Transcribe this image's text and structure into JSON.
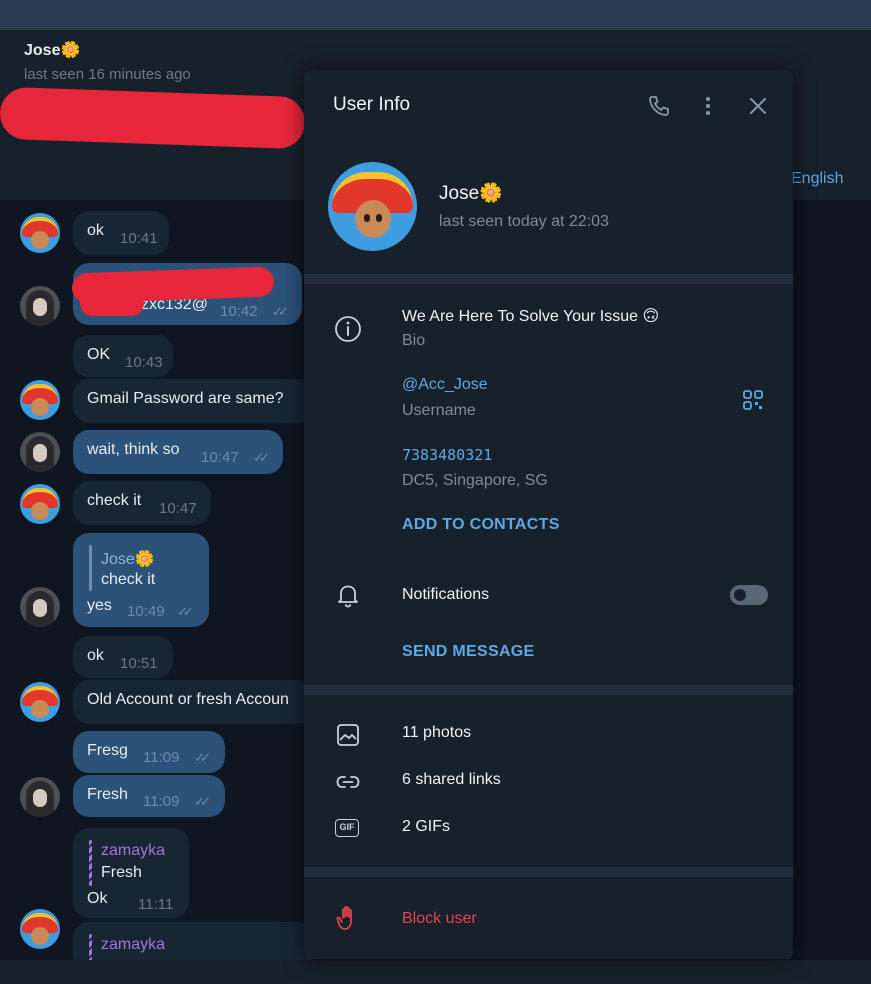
{
  "chat": {
    "name": "Jose🌼",
    "status": "last seen 16 minutes ago",
    "translate_label": "English"
  },
  "messages": [
    {
      "text": "ok",
      "time": "10:41"
    },
    {
      "text": "zxc132@",
      "time": "10:42"
    },
    {
      "text": "OK",
      "time": "10:43"
    },
    {
      "text": "Gmail Password are same?",
      "time": ""
    },
    {
      "text": "wait, think so",
      "time": "10:47"
    },
    {
      "text": "check it",
      "time": "10:47"
    },
    {
      "reply_name": "Jose🌼",
      "reply_text": "check it",
      "text": "yes",
      "time": "10:49"
    },
    {
      "text": "ok",
      "time": "10:51"
    },
    {
      "text": "Old Account or fresh Accoun",
      "time": ""
    },
    {
      "text": "Fresg",
      "time": "11:09"
    },
    {
      "text": "Fresh",
      "time": "11:09"
    },
    {
      "reply_name": "zamayka",
      "reply_text": "Fresh",
      "text": "Ok",
      "time": "11:11"
    },
    {
      "reply_name": "zamayka"
    }
  ],
  "user_info": {
    "title": "User Info",
    "name": "Jose🌼",
    "last_seen": "last seen today at 22:03",
    "bio": "We Are Here To Solve Your Issue 🙃",
    "bio_label": "Bio",
    "username": "@Acc_Jose",
    "username_label": "Username",
    "phone": "7383480321",
    "phone_sub": "DC5, Singapore, SG",
    "add_contacts": "ADD TO CONTACTS",
    "notifications_label": "Notifications",
    "notifications_on": false,
    "send_message": "SEND MESSAGE",
    "photos": "11 photos",
    "links": "6 shared links",
    "gifs": "2 GIFs",
    "gif_icon_text": "GIF",
    "block": "Block user"
  },
  "colors": {
    "accent": "#5fa8e3",
    "danger": "#e5434f",
    "panel_bg": "#17212b",
    "chat_bg": "#0e1621",
    "outgoing_bubble": "#2b5278",
    "incoming_bubble": "#182533",
    "reply_purple": "#a276d8"
  },
  "icons": [
    "phone-icon",
    "more-vertical-icon",
    "close-icon",
    "info-icon",
    "qr-code-icon",
    "bell-icon",
    "photo-icon",
    "link-icon",
    "gif-icon",
    "hand-block-icon",
    "double-check-icon"
  ]
}
